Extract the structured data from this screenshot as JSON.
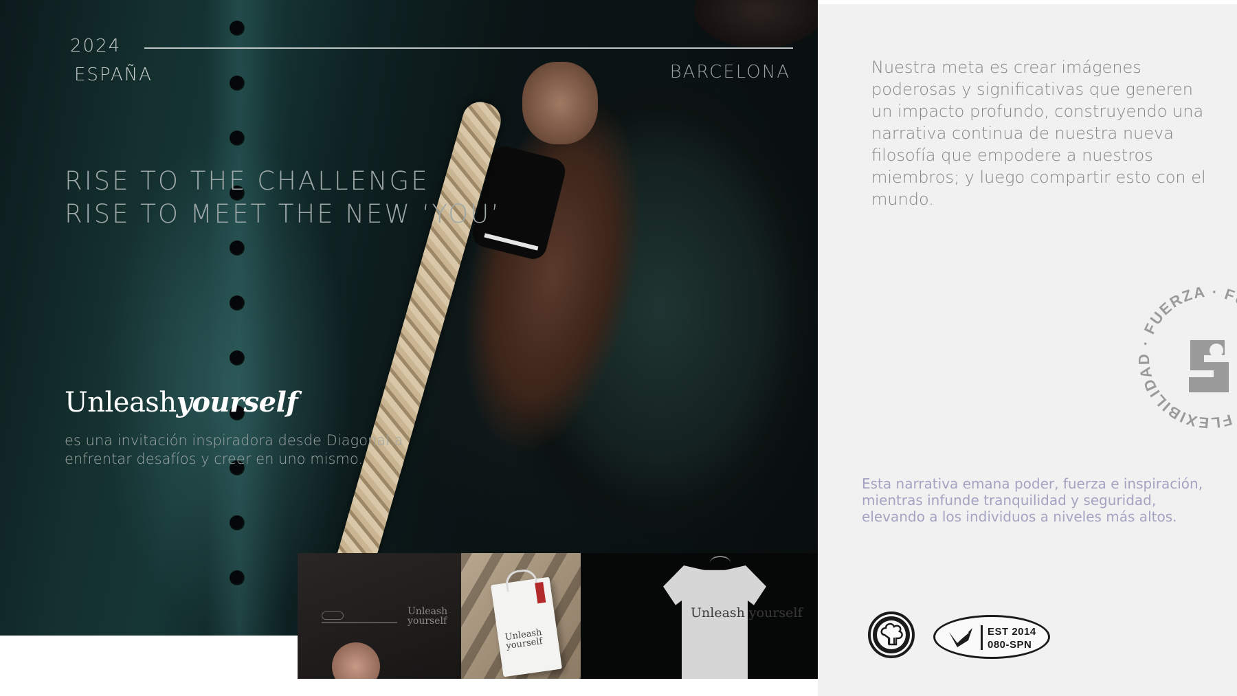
{
  "left": {
    "year": "2024",
    "country": "ESPAÑA",
    "city": "BARCELONA",
    "headline_line1": "RISE TO THE CHALLENGE",
    "headline_line2": "RISE TO MEET THE NEW ‘YOU’",
    "brand_regular": "Unleash",
    "brand_bold": "yourself",
    "invitation": "es una invitación inspiradora desde Diagonal a enfrentar desafíos y creer en uno mismo."
  },
  "merch": {
    "bag_text": "Unleash yourself",
    "tee_text": "Unleash yourself",
    "shirt_text": "Unleash yourself"
  },
  "right": {
    "mission": "Nuestra meta es crear imágenes poderosas y significativas que generen un impacto profundo, construyendo una narrativa continua de nuestra nueva filosofía que empodere a nuestros miembros; y luego compartir esto con el mundo.",
    "narrative": "Esta narrativa emana poder, fuerza e inspiración, mientras infunde tranquilidad y seguridad, elevando a los individuos a niveles más altos.",
    "seal_text": "FLEXIBILIDAD · FUERZA · FUERZA · ",
    "badge_est": "EST 2014",
    "badge_code": "080-SPN"
  },
  "colors": {
    "panel_bg": "#f1f1f1",
    "narrative_text": "#a4a3c2",
    "mission_text": "#858585",
    "badge": "#1b1b1b"
  },
  "icons": [
    "brain-tree-icon",
    "shield-check-icon",
    "s-monogram-icon"
  ]
}
